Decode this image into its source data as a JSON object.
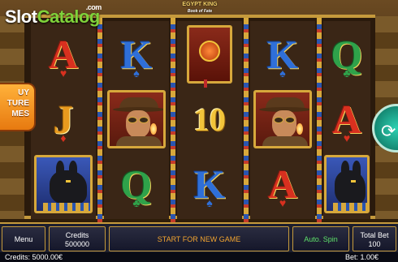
{
  "watermark": {
    "slot": "Slot",
    "catalog": "Catalog",
    "com": ".com"
  },
  "game_logo": {
    "title": "EGYPT KING",
    "subtitle": "Book of Fate"
  },
  "buy_feature": {
    "label_line1": "UY",
    "label_line2": "TURE",
    "label_line3": "MES"
  },
  "reels": [
    [
      {
        "symbol": "A",
        "kind": "ace"
      },
      {
        "symbol": "J",
        "kind": "jack"
      },
      {
        "symbol": "anubis",
        "kind": "anubis"
      }
    ],
    [
      {
        "symbol": "K",
        "kind": "king"
      },
      {
        "symbol": "explorer",
        "kind": "character"
      },
      {
        "symbol": "Q",
        "kind": "queen"
      }
    ],
    [
      {
        "symbol": "book",
        "kind": "book"
      },
      {
        "symbol": "10",
        "kind": "ten"
      },
      {
        "symbol": "K",
        "kind": "king"
      }
    ],
    [
      {
        "symbol": "K",
        "kind": "king"
      },
      {
        "symbol": "explorer",
        "kind": "character"
      },
      {
        "symbol": "A",
        "kind": "ace"
      }
    ],
    [
      {
        "symbol": "Q",
        "kind": "queen"
      },
      {
        "symbol": "A",
        "kind": "ace"
      },
      {
        "symbol": "anubis",
        "kind": "anubis"
      }
    ]
  ],
  "panel": {
    "menu": "Menu",
    "credits_label": "Credits",
    "credits_value": "500000",
    "message": "START FOR NEW GAME",
    "autospin": "Auto. Spin",
    "totalbet_label": "Total Bet",
    "totalbet_value": "100"
  },
  "status": {
    "credits": "Credits: 5000.00€",
    "bet": "Bet: 1.00€"
  },
  "colors": {
    "ace": "#d8301f",
    "king": "#2f6fd8",
    "queen": "#2fa24a",
    "jack": "#e89a1e",
    "gold": "#c59a3c"
  }
}
